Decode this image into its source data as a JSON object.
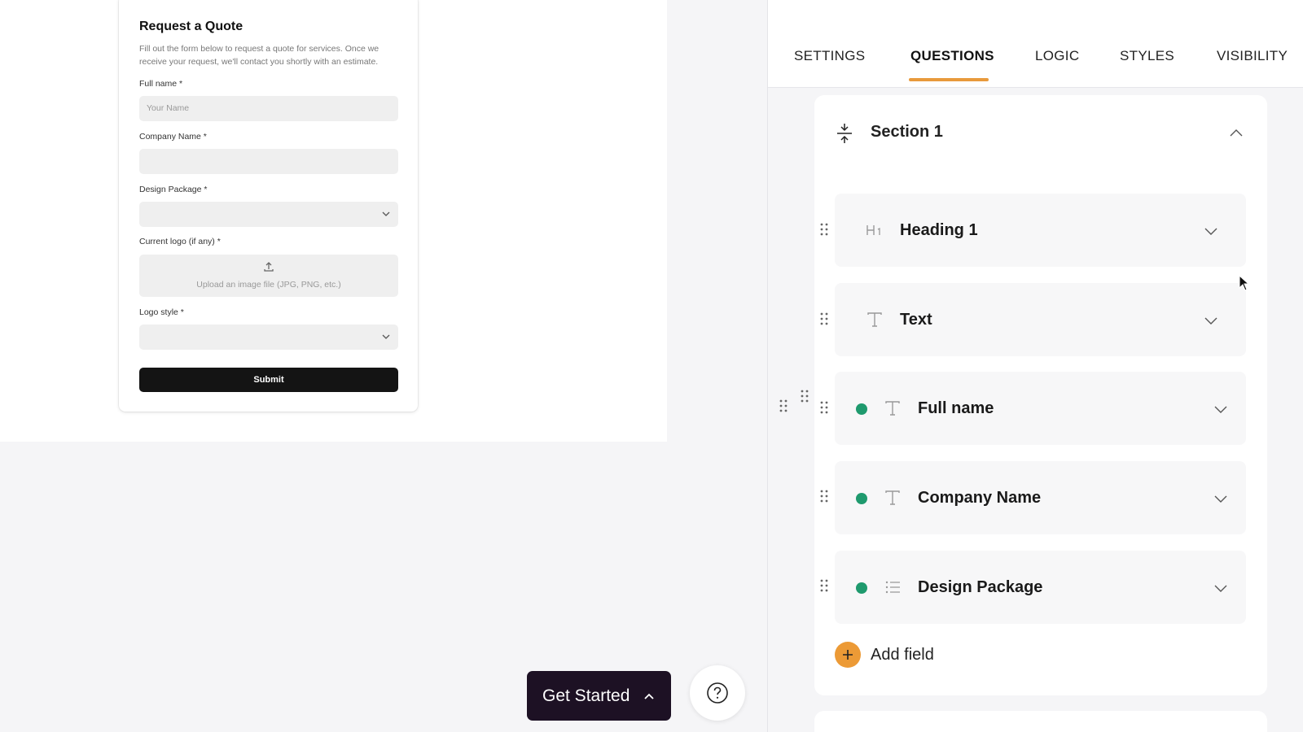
{
  "form": {
    "title": "Request a Quote",
    "description": "Fill out the form below to request a quote for services. Once we receive your request, we'll contact you shortly with an estimate.",
    "fields": {
      "full_name": {
        "label": "Full name *",
        "placeholder": "Your Name"
      },
      "company_name": {
        "label": "Company Name *",
        "placeholder": ""
      },
      "design_package": {
        "label": "Design Package *",
        "value": ""
      },
      "current_logo": {
        "label": "Current logo (if any) *",
        "upload_hint": "Upload an image file (JPG, PNG, etc.)"
      },
      "logo_style": {
        "label": "Logo style *",
        "value": ""
      }
    },
    "submit_label": "Submit"
  },
  "floating": {
    "get_started_label": "Get Started",
    "help_icon": "question-circle-icon"
  },
  "panel": {
    "tabs": [
      {
        "label": "SETTINGS",
        "active": false
      },
      {
        "label": "QUESTIONS",
        "active": true
      },
      {
        "label": "LOGIC",
        "active": false
      },
      {
        "label": "STYLES",
        "active": false
      },
      {
        "label": "VISIBILITY",
        "active": false
      }
    ],
    "accent_color": "#e89a3c",
    "section": {
      "title": "Section 1",
      "items": [
        {
          "label": "Heading 1",
          "icon": "heading-icon",
          "required_dot": false
        },
        {
          "label": "Text",
          "icon": "text-icon",
          "required_dot": false
        },
        {
          "label": "Full name",
          "icon": "text-icon",
          "required_dot": true
        },
        {
          "label": "Company Name",
          "icon": "text-icon",
          "required_dot": true
        },
        {
          "label": "Design Package",
          "icon": "list-icon",
          "required_dot": true
        }
      ],
      "add_field_label": "Add field"
    },
    "status_dot_color": "#1f9a6e"
  }
}
